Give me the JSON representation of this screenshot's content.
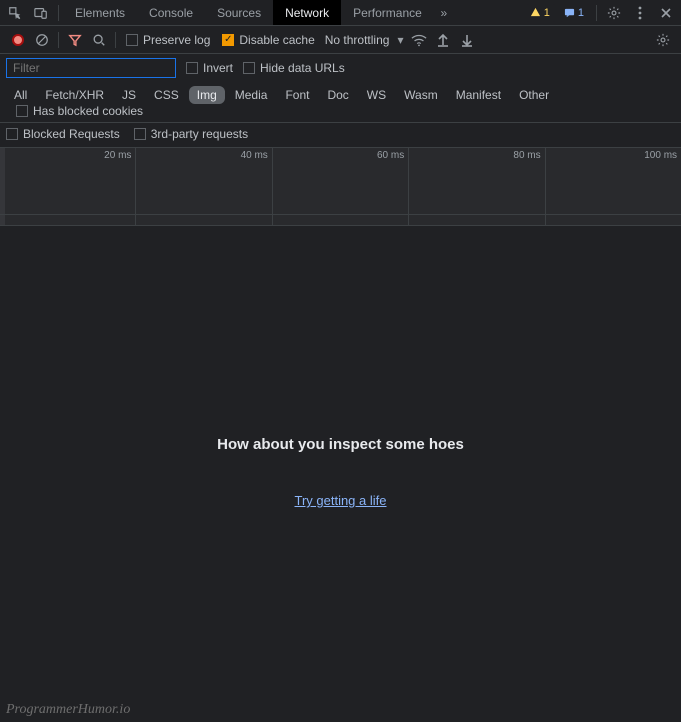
{
  "tabs": {
    "items": [
      "Elements",
      "Console",
      "Sources",
      "Network",
      "Performance"
    ],
    "active_index": 3,
    "overflow_icon": "»"
  },
  "badges": {
    "warn_count": "1",
    "info_count": "1"
  },
  "toolbar": {
    "preserve_log": "Preserve log",
    "preserve_log_checked": false,
    "disable_cache": "Disable cache",
    "disable_cache_checked": true,
    "throttling": "No throttling"
  },
  "filter": {
    "placeholder": "Filter",
    "value": "",
    "invert": "Invert",
    "hide_data": "Hide data URLs",
    "types": [
      "All",
      "Fetch/XHR",
      "JS",
      "CSS",
      "Img",
      "Media",
      "Font",
      "Doc",
      "WS",
      "Wasm",
      "Manifest",
      "Other"
    ],
    "active_type_index": 4,
    "has_blocked": "Has blocked cookies",
    "blocked_requests": "Blocked Requests",
    "third_party": "3rd-party requests"
  },
  "timeline": {
    "ticks": [
      "20 ms",
      "40 ms",
      "60 ms",
      "80 ms",
      "100 ms"
    ]
  },
  "main": {
    "message": "How about you inspect some hoes",
    "link": "Try getting a life"
  },
  "watermark": "ProgrammerHumor.io"
}
